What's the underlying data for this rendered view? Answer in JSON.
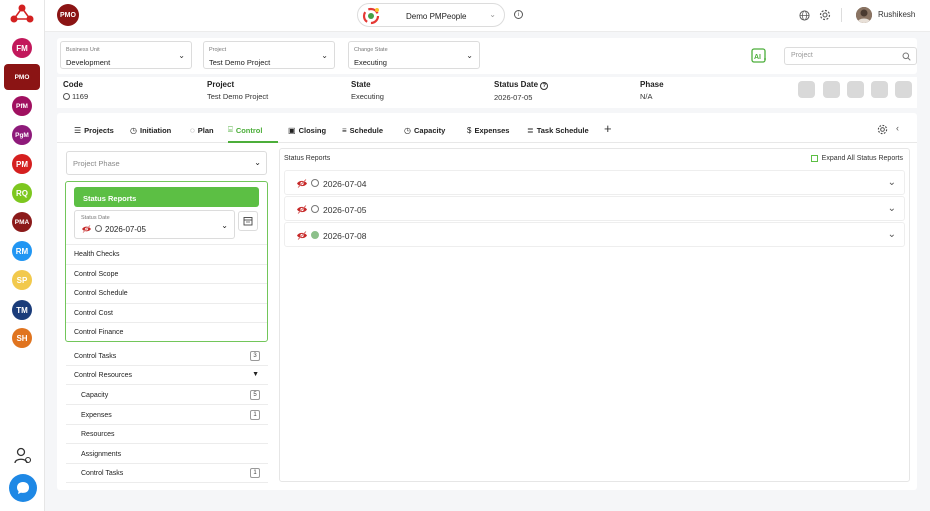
{
  "rail": {
    "items": [
      {
        "label": "FM",
        "color": "#c2185b"
      },
      {
        "label": "PMO",
        "color": "#8b1414"
      },
      {
        "label": "PfM",
        "color": "#a01060"
      },
      {
        "label": "PgM",
        "color": "#8e1a7a"
      },
      {
        "label": "PM",
        "color": "#d51f1f"
      },
      {
        "label": "RQ",
        "color": "#7dc71f"
      },
      {
        "label": "PMA",
        "color": "#8b1a1a"
      },
      {
        "label": "RM",
        "color": "#2196f3"
      },
      {
        "label": "SP",
        "color": "#f2c94c"
      },
      {
        "label": "TM",
        "color": "#1a3c7a"
      },
      {
        "label": "SH",
        "color": "#e0741f"
      }
    ]
  },
  "topbar": {
    "badge": "PMO",
    "product": "Demo PMPeople",
    "user": "Rushikesh"
  },
  "filters": {
    "business_unit": {
      "label": "Business Unit",
      "value": "Development"
    },
    "project": {
      "label": "Project",
      "value": "Test Demo Project"
    },
    "change_state": {
      "label": "Change State",
      "value": "Executing"
    },
    "search_placeholder": "Project"
  },
  "info": {
    "code": {
      "label": "Code",
      "value": "1169"
    },
    "project": {
      "label": "Project",
      "value": "Test Demo Project"
    },
    "state": {
      "label": "State",
      "value": "Executing"
    },
    "status_date": {
      "label": "Status Date",
      "value": "2026-07-05"
    },
    "phase": {
      "label": "Phase",
      "value": "N/A"
    }
  },
  "tabs": [
    {
      "label": "Projects",
      "icon": "list-icon"
    },
    {
      "label": "Initiation",
      "icon": "clock-icon"
    },
    {
      "label": "Plan",
      "icon": "bulb-icon"
    },
    {
      "label": "Control",
      "icon": "control-icon"
    },
    {
      "label": "Closing",
      "icon": "closing-icon"
    },
    {
      "label": "Schedule",
      "icon": "schedule-icon"
    },
    {
      "label": "Capacity",
      "icon": "clock-icon"
    },
    {
      "label": "Expenses",
      "icon": "dollar-icon"
    },
    {
      "label": "Task Schedule",
      "icon": "task-icon"
    }
  ],
  "left": {
    "phase_placeholder": "Project Phase",
    "status_reports_btn": "Status Reports",
    "status_date_label": "Status Date",
    "status_date_value": "2026-07-05",
    "sr_items": [
      "Health Checks",
      "Control Scope",
      "Control Schedule",
      "Control Cost",
      "Control Finance"
    ],
    "control_tasks": {
      "label": "Control Tasks",
      "count": "3"
    },
    "control_resources": {
      "label": "Control Resources"
    },
    "sub_items": [
      {
        "label": "Capacity",
        "count": "5"
      },
      {
        "label": "Expenses",
        "count": "1"
      },
      {
        "label": "Resources",
        "count": ""
      },
      {
        "label": "Assignments",
        "count": ""
      },
      {
        "label": "Control Tasks",
        "count": "1"
      }
    ]
  },
  "right": {
    "title": "Status Reports",
    "expand_label": "Expand All Status Reports",
    "reports": [
      {
        "date": "2026-07-04",
        "status": "empty"
      },
      {
        "date": "2026-07-05",
        "status": "empty"
      },
      {
        "date": "2026-07-08",
        "status": "green"
      }
    ]
  },
  "colors": {
    "accent": "#5cbf44",
    "brand": "#8b1414",
    "chat": "#1e88e5"
  }
}
